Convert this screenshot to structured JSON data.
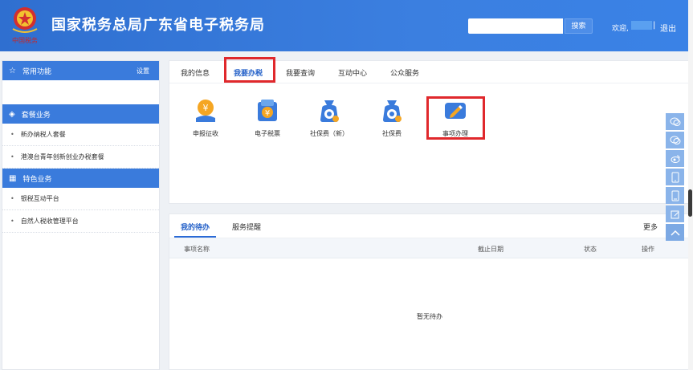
{
  "header": {
    "title": "国家税务总局广东省电子税务局",
    "logo_text": "中国税务",
    "search": {
      "placeholder": "",
      "button": "搜索"
    },
    "welcome": "欢迎,",
    "separator": "|",
    "logout": "退出"
  },
  "sidebar": {
    "common": {
      "label": "常用功能",
      "settings": "设置"
    },
    "package": {
      "label": "套餐业务"
    },
    "package_items": [
      "新办纳税人套餐",
      "港澳台青年创新创业办税套餐"
    ],
    "special": {
      "label": "特色业务"
    },
    "special_items": [
      "银税互动平台",
      "自然人税收管理平台"
    ]
  },
  "top_tabs": [
    "我的信息",
    "我要办税",
    "我要查询",
    "互动中心",
    "公众服务"
  ],
  "active_top_tab": "我要办税",
  "tiles": [
    {
      "label": "申报征收",
      "icon": "tax-declare-icon"
    },
    {
      "label": "电子税票",
      "icon": "e-tax-ticket-icon"
    },
    {
      "label": "社保费（新）",
      "icon": "social-security-new-icon"
    },
    {
      "label": "社保费",
      "icon": "social-security-icon"
    },
    {
      "label": "事项办理",
      "icon": "matter-handling-icon"
    }
  ],
  "bottom_tabs": [
    "我的待办",
    "服务提醒"
  ],
  "more": "更多",
  "table_headers": [
    "事项名称",
    "截止日期",
    "状态",
    "操作"
  ],
  "empty_text": "暂无待办",
  "colors": {
    "header": "#3b7fe0",
    "accent": "#2a6ad6",
    "highlight": "#e0282c",
    "sidebar_head": "#3a7bdc"
  }
}
